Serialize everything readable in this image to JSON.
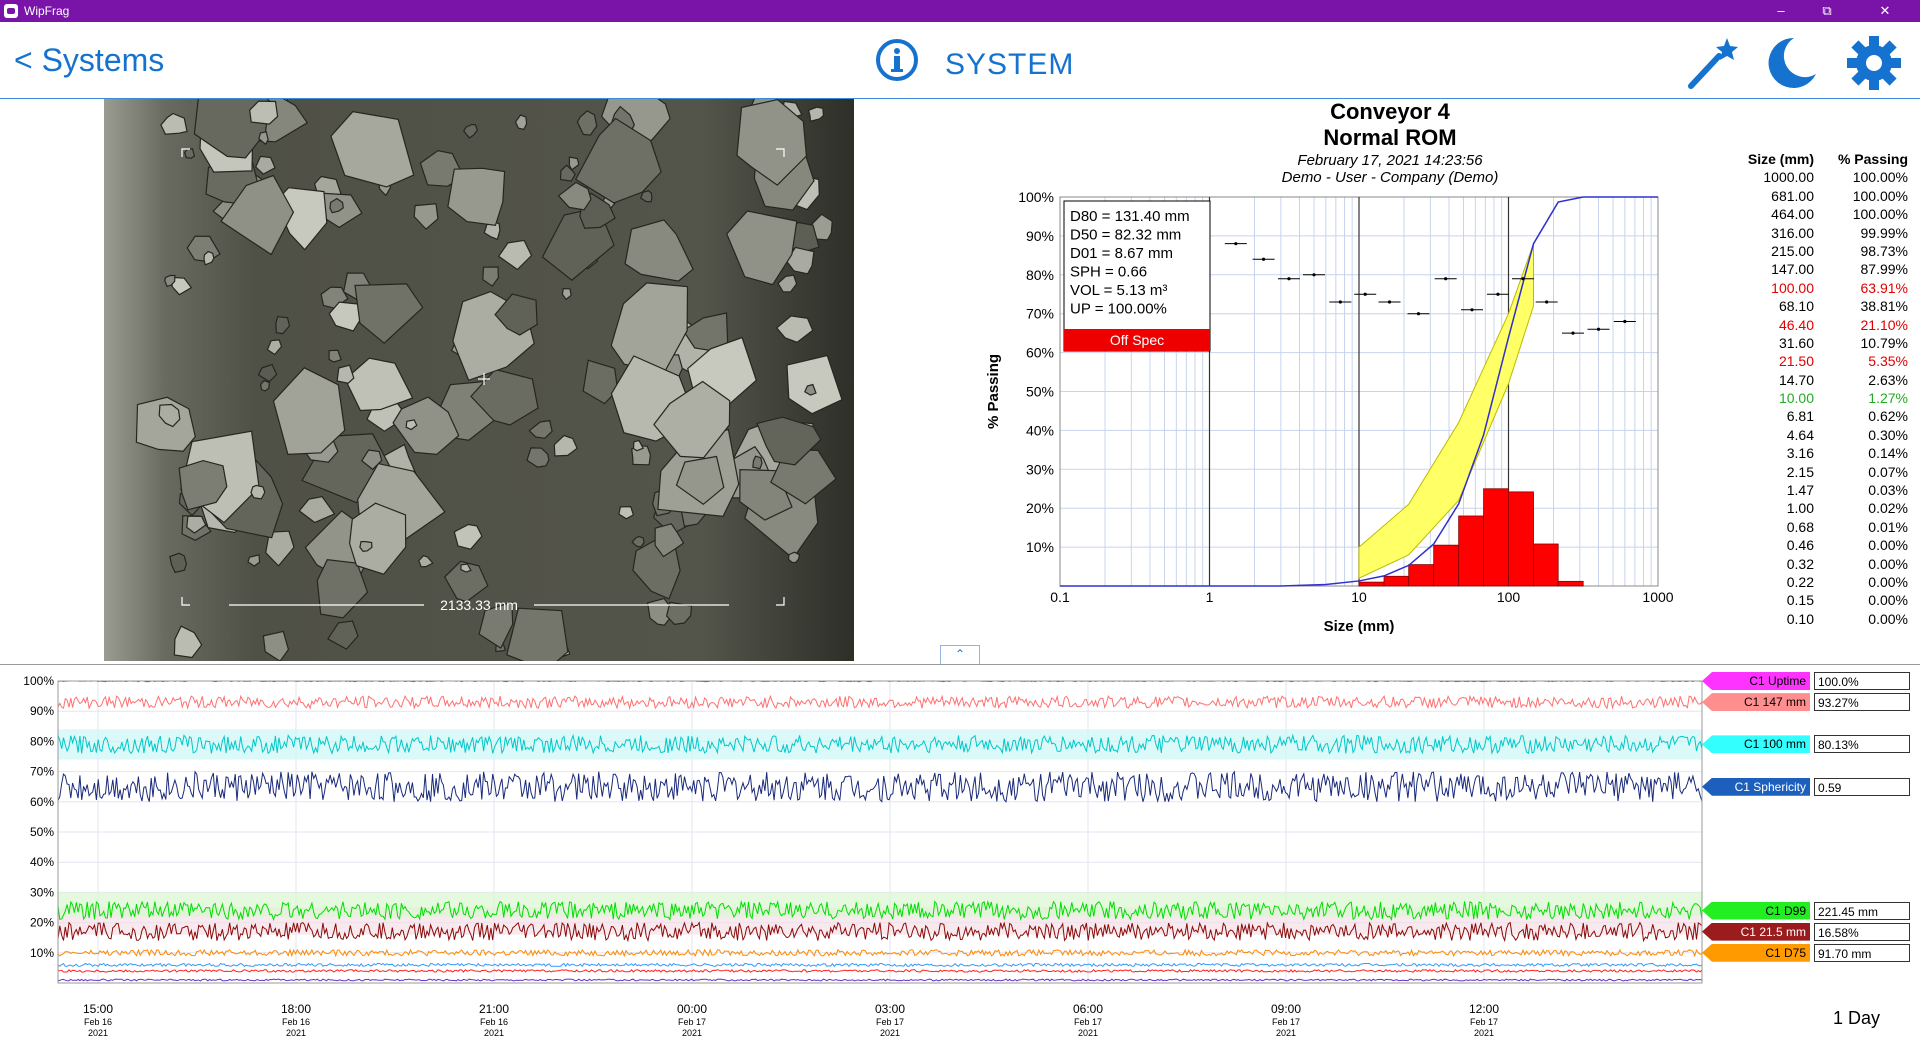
{
  "app": {
    "title": "WipFrag"
  },
  "header": {
    "back_label": "< Systems",
    "title": "SYSTEM"
  },
  "photo": {
    "scale_label": "2133.33 mm"
  },
  "psd": {
    "title": "Conveyor 4",
    "subtitle": "Normal ROM",
    "date": "February 17, 2021 14:23:56",
    "user": "Demo  -  User - Company (Demo)",
    "stats": [
      "D80 = 131.40 mm",
      "D50 = 82.32 mm",
      "D01 = 8.67 mm",
      "SPH = 0.66",
      "VOL = 5.13 m³",
      "UP = 100.00%"
    ],
    "status": "Off Spec",
    "table_headers": [
      "Size (mm)",
      "% Passing"
    ],
    "table": [
      [
        "1000.00",
        "100.00%",
        "#000"
      ],
      [
        "681.00",
        "100.00%",
        "#000"
      ],
      [
        "464.00",
        "100.00%",
        "#000"
      ],
      [
        "316.00",
        "99.99%",
        "#000"
      ],
      [
        "215.00",
        "98.73%",
        "#000"
      ],
      [
        "147.00",
        "87.99%",
        "#000"
      ],
      [
        "100.00",
        "63.91%",
        "#e00000"
      ],
      [
        "68.10",
        "38.81%",
        "#000"
      ],
      [
        "46.40",
        "21.10%",
        "#e00000"
      ],
      [
        "31.60",
        "10.79%",
        "#000"
      ],
      [
        "21.50",
        "5.35%",
        "#e00000"
      ],
      [
        "14.70",
        "2.63%",
        "#000"
      ],
      [
        "10.00",
        "1.27%",
        "#22aa22"
      ],
      [
        "6.81",
        "0.62%",
        "#000"
      ],
      [
        "4.64",
        "0.30%",
        "#000"
      ],
      [
        "3.16",
        "0.14%",
        "#000"
      ],
      [
        "2.15",
        "0.07%",
        "#000"
      ],
      [
        "1.47",
        "0.03%",
        "#000"
      ],
      [
        "1.00",
        "0.02%",
        "#000"
      ],
      [
        "0.68",
        "0.01%",
        "#000"
      ],
      [
        "0.46",
        "0.00%",
        "#000"
      ],
      [
        "0.32",
        "0.00%",
        "#000"
      ],
      [
        "0.22",
        "0.00%",
        "#000"
      ],
      [
        "0.15",
        "0.00%",
        "#000"
      ],
      [
        "0.10",
        "0.00%",
        "#000"
      ]
    ]
  },
  "chart_data": [
    {
      "type": "line",
      "xlabel": "Size (mm)",
      "ylabel": "% Passing",
      "xscale": "log",
      "xlim": [
        0.1,
        1000
      ],
      "ylim": [
        0,
        100
      ],
      "x_ticks": [
        "0.1",
        "1",
        "10",
        "100",
        "1000"
      ],
      "y_ticks": [
        "10%",
        "20%",
        "30%",
        "40%",
        "50%",
        "60%",
        "70%",
        "80%",
        "90%",
        "100%"
      ],
      "series": [
        {
          "role": "passing-curve",
          "color": "#3030d0",
          "points": [
            [
              0.1,
              0
            ],
            [
              1,
              0
            ],
            [
              3,
              0
            ],
            [
              6,
              0.4
            ],
            [
              10,
              1.3
            ],
            [
              14.7,
              2.6
            ],
            [
              21.5,
              5.3
            ],
            [
              31.6,
              10.8
            ],
            [
              46.4,
              21.1
            ],
            [
              68.1,
              38.8
            ],
            [
              100,
              63.9
            ],
            [
              147,
              88
            ],
            [
              215,
              98.7
            ],
            [
              316,
              100
            ],
            [
              1000,
              100
            ]
          ]
        },
        {
          "role": "spec-band",
          "color": "#ffff66",
          "upper": [
            [
              10,
              10
            ],
            [
              21.5,
              21
            ],
            [
              46.4,
              42
            ],
            [
              100,
              70
            ],
            [
              147,
              88
            ]
          ],
          "lower": [
            [
              10,
              2
            ],
            [
              21.5,
              8
            ],
            [
              46.4,
              22
            ],
            [
              100,
              52
            ],
            [
              147,
              72
            ]
          ]
        },
        {
          "role": "histogram",
          "color": "#ff0000",
          "bins": [
            [
              10,
              14.7,
              1
            ],
            [
              14.7,
              21.5,
              2.5
            ],
            [
              21.5,
              31.6,
              5.5
            ],
            [
              31.6,
              46.4,
              10.5
            ],
            [
              46.4,
              68.1,
              18
            ],
            [
              68.1,
              100,
              25
            ],
            [
              100,
              147,
              24.2
            ],
            [
              147,
              215,
              10.8
            ],
            [
              215,
              316,
              1.2
            ]
          ]
        },
        {
          "role": "history-markers",
          "color": "#000000",
          "points": [
            [
              0.8,
              82
            ],
            [
              1.5,
              88
            ],
            [
              2.3,
              84
            ],
            [
              3.4,
              79
            ],
            [
              5,
              80
            ],
            [
              7.5,
              73
            ],
            [
              11,
              75
            ],
            [
              16,
              73
            ],
            [
              25,
              70
            ],
            [
              38,
              79
            ],
            [
              57,
              71
            ],
            [
              85,
              75
            ],
            [
              125,
              79
            ],
            [
              180,
              73
            ],
            [
              270,
              65
            ],
            [
              400,
              66
            ],
            [
              600,
              68
            ]
          ]
        }
      ],
      "vlines": [
        1,
        10,
        100
      ]
    },
    {
      "type": "line",
      "x_ticks": [
        {
          "time": "15:00",
          "date": "Feb 16",
          "year": "2021"
        },
        {
          "time": "18:00",
          "date": "Feb 16",
          "year": "2021"
        },
        {
          "time": "21:00",
          "date": "Feb 16",
          "year": "2021"
        },
        {
          "time": "00:00",
          "date": "Feb 17",
          "year": "2021"
        },
        {
          "time": "03:00",
          "date": "Feb 17",
          "year": "2021"
        },
        {
          "time": "06:00",
          "date": "Feb 17",
          "year": "2021"
        },
        {
          "time": "09:00",
          "date": "Feb 17",
          "year": "2021"
        },
        {
          "time": "12:00",
          "date": "Feb 17",
          "year": "2021"
        }
      ],
      "y_ticks": [
        "100%",
        "90%",
        "80%",
        "70%",
        "60%",
        "50%",
        "40%",
        "30%",
        "20%",
        "10%"
      ],
      "ylim": [
        0,
        100
      ],
      "series": [
        {
          "name": "C1 Uptime",
          "value": "100.0%",
          "color": "#ff33ff",
          "line": "#cc00cc",
          "mean": 100,
          "noise": 0.2
        },
        {
          "name": "C1 147 mm",
          "value": "93.27%",
          "color": "#ff8f8f",
          "line": "#ff7070",
          "mean": 93,
          "noise": 2
        },
        {
          "name": "C1 100 mm",
          "value": "80.13%",
          "color": "#33ffff",
          "line": "#00c8c8",
          "mean": 79,
          "noise": 3
        },
        {
          "name": "C1 Sphericity",
          "value": "0.59",
          "color": "#1c5fbc",
          "line": "#1a2a7a",
          "mean": 65,
          "noise": 5
        },
        {
          "name": "C1 D99",
          "value": "221.45 mm",
          "color": "#22ee22",
          "line": "#00dd00",
          "mean": 24,
          "noise": 3
        },
        {
          "name": "C1 21.5 mm",
          "value": "16.58%",
          "color": "#9b1c1c",
          "line": "#8a0a0a",
          "mean": 17,
          "noise": 3
        },
        {
          "name": "C1 D75",
          "value": "91.70 mm",
          "color": "#ff9a00",
          "line": "#ff8800",
          "mean": 10,
          "noise": 1
        },
        {
          "name": "",
          "value": "",
          "color": "#3399ff",
          "line": "#3399ff",
          "mean": 6,
          "noise": 0.5
        },
        {
          "name": "",
          "value": "",
          "color": "#ff2020",
          "line": "#ff2020",
          "mean": 4,
          "noise": 0.4
        },
        {
          "name": "",
          "value": "",
          "color": "#6633cc",
          "line": "#6633cc",
          "mean": 1,
          "noise": 0.3
        }
      ],
      "range_label": "1 Day"
    }
  ]
}
